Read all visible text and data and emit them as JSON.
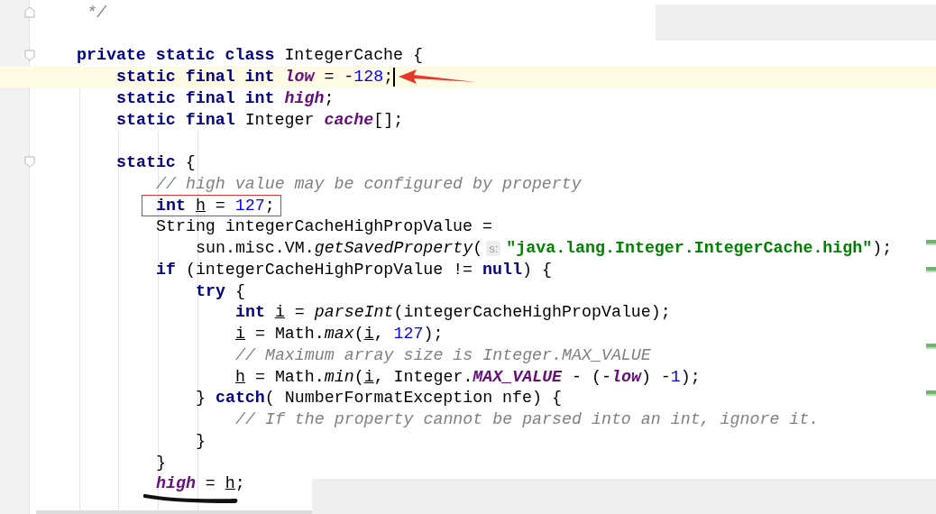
{
  "editor": {
    "lines": [
      {
        "kind": "code",
        "fold_end": true,
        "tokens": [
          {
            "kind": "comment",
            "text": " */"
          }
        ]
      },
      {
        "kind": "blank"
      },
      {
        "kind": "code",
        "fold_start": true,
        "tokens": [
          {
            "kind": "kw",
            "text": "private static class"
          },
          {
            "kind": "plain",
            "text": " IntegerCache {"
          }
        ],
        "children": [
          {
            "kind": "code",
            "current": true,
            "arrow": true,
            "tokens": [
              {
                "kind": "kw",
                "text": "static final int "
              },
              {
                "kind": "field",
                "text": "low"
              },
              {
                "kind": "plain",
                "text": " = -"
              },
              {
                "kind": "num",
                "text": "128"
              },
              {
                "kind": "plain",
                "text": ";"
              }
            ]
          },
          {
            "kind": "code",
            "tokens": [
              {
                "kind": "kw",
                "text": "static final int "
              },
              {
                "kind": "field",
                "text": "high"
              },
              {
                "kind": "plain",
                "text": ";"
              }
            ]
          },
          {
            "kind": "code",
            "tokens": [
              {
                "kind": "kw",
                "text": "static final"
              },
              {
                "kind": "plain",
                "text": " Integer "
              },
              {
                "kind": "field",
                "text": "cache"
              },
              {
                "kind": "plain",
                "text": "[];"
              }
            ]
          },
          {
            "kind": "blank"
          },
          {
            "kind": "code",
            "fold_start": true,
            "tokens": [
              {
                "kind": "kw",
                "text": "static"
              },
              {
                "kind": "plain",
                "text": " {"
              }
            ],
            "children": [
              {
                "kind": "code",
                "tokens": [
                  {
                    "kind": "comment",
                    "text": "// high value may be configured by property"
                  }
                ]
              },
              {
                "kind": "code",
                "boxed": true,
                "tokens": [
                  {
                    "kind": "kw",
                    "text": "int "
                  },
                  {
                    "kind": "local",
                    "text": "h"
                  },
                  {
                    "kind": "plain",
                    "text": " = "
                  },
                  {
                    "kind": "num",
                    "text": "127"
                  },
                  {
                    "kind": "plain",
                    "text": ";"
                  }
                ]
              },
              {
                "kind": "code",
                "tokens": [
                  {
                    "kind": "plain",
                    "text": "String integerCacheHighPropValue ="
                  }
                ],
                "children": [
                  {
                    "kind": "code",
                    "tokens": [
                      {
                        "kind": "plain",
                        "text": "sun.misc.VM."
                      },
                      {
                        "kind": "method",
                        "text": "getSavedProperty"
                      },
                      {
                        "kind": "plain",
                        "text": "("
                      },
                      {
                        "kind": "hint",
                        "text": "s:"
                      },
                      {
                        "kind": "string",
                        "text": "\"java.lang.Integer.IntegerCache.high\""
                      },
                      {
                        "kind": "plain",
                        "text": ");"
                      }
                    ]
                  }
                ]
              },
              {
                "kind": "code",
                "tokens": [
                  {
                    "kind": "kw",
                    "text": "if"
                  },
                  {
                    "kind": "plain",
                    "text": " (integerCacheHighPropValue != "
                  },
                  {
                    "kind": "kw",
                    "text": "null"
                  },
                  {
                    "kind": "plain",
                    "text": ") {"
                  }
                ],
                "children": [
                  {
                    "kind": "code",
                    "tokens": [
                      {
                        "kind": "kw",
                        "text": "try"
                      },
                      {
                        "kind": "plain",
                        "text": " {"
                      }
                    ],
                    "children": [
                      {
                        "kind": "code",
                        "tokens": [
                          {
                            "kind": "kw",
                            "text": "int "
                          },
                          {
                            "kind": "local",
                            "text": "i"
                          },
                          {
                            "kind": "plain",
                            "text": " = "
                          },
                          {
                            "kind": "method",
                            "text": "parseInt"
                          },
                          {
                            "kind": "plain",
                            "text": "(integerCacheHighPropValue);"
                          }
                        ]
                      },
                      {
                        "kind": "code",
                        "tokens": [
                          {
                            "kind": "local",
                            "text": "i"
                          },
                          {
                            "kind": "plain",
                            "text": " = Math."
                          },
                          {
                            "kind": "method",
                            "text": "max"
                          },
                          {
                            "kind": "plain",
                            "text": "("
                          },
                          {
                            "kind": "local",
                            "text": "i"
                          },
                          {
                            "kind": "plain",
                            "text": ", "
                          },
                          {
                            "kind": "num",
                            "text": "127"
                          },
                          {
                            "kind": "plain",
                            "text": ");"
                          }
                        ]
                      },
                      {
                        "kind": "code",
                        "tokens": [
                          {
                            "kind": "comment",
                            "text": "// Maximum array size is Integer.MAX_VALUE"
                          }
                        ]
                      },
                      {
                        "kind": "code",
                        "tokens": [
                          {
                            "kind": "local",
                            "text": "h"
                          },
                          {
                            "kind": "plain",
                            "text": " = Math."
                          },
                          {
                            "kind": "method",
                            "text": "min"
                          },
                          {
                            "kind": "plain",
                            "text": "("
                          },
                          {
                            "kind": "local",
                            "text": "i"
                          },
                          {
                            "kind": "plain",
                            "text": ", Integer."
                          },
                          {
                            "kind": "field",
                            "text": "MAX_VALUE"
                          },
                          {
                            "kind": "plain",
                            "text": " - (-"
                          },
                          {
                            "kind": "field",
                            "text": "low"
                          },
                          {
                            "kind": "plain",
                            "text": ") -"
                          },
                          {
                            "kind": "num",
                            "text": "1"
                          },
                          {
                            "kind": "plain",
                            "text": ");"
                          }
                        ]
                      }
                    ]
                  },
                  {
                    "kind": "code",
                    "tokens": [
                      {
                        "kind": "plain",
                        "text": "} "
                      },
                      {
                        "kind": "kw",
                        "text": "catch"
                      },
                      {
                        "kind": "plain",
                        "text": "( NumberFormatException nfe) {"
                      }
                    ],
                    "children": [
                      {
                        "kind": "code",
                        "tokens": [
                          {
                            "kind": "comment",
                            "text": "// If the property cannot be parsed into an int, ignore it."
                          }
                        ]
                      }
                    ]
                  },
                  {
                    "kind": "code",
                    "tokens": [
                      {
                        "kind": "plain",
                        "text": "}"
                      }
                    ]
                  }
                ]
              },
              {
                "kind": "code",
                "tokens": [
                  {
                    "kind": "plain",
                    "text": "}"
                  }
                ]
              },
              {
                "kind": "code",
                "underlined": true,
                "tokens": [
                  {
                    "kind": "field",
                    "text": "high"
                  },
                  {
                    "kind": "plain",
                    "text": " = "
                  },
                  {
                    "kind": "local",
                    "text": "h"
                  },
                  {
                    "kind": "plain",
                    "text": ";"
                  }
                ]
              }
            ]
          }
        ]
      }
    ]
  }
}
